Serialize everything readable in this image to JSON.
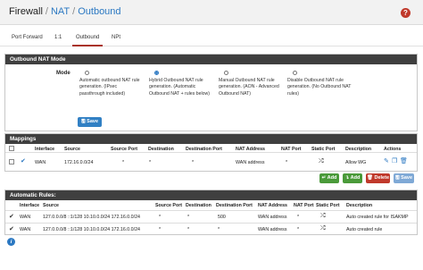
{
  "breadcrumb": {
    "part1": "Firewall",
    "sep1": "/",
    "part2": "NAT",
    "sep2": "/",
    "part3": "Outbound"
  },
  "help_icon": "?",
  "tabs": [
    {
      "label": "Port Forward",
      "active": false
    },
    {
      "label": "1:1",
      "active": false
    },
    {
      "label": "Outbound",
      "active": true
    },
    {
      "label": "NPt",
      "active": false
    }
  ],
  "mode_panel": {
    "title": "Outbound NAT Mode",
    "mode_label": "Mode",
    "options": [
      {
        "text": "Automatic outbound NAT rule generation. (IPsec passthrough included)",
        "checked": false
      },
      {
        "text": "Hybrid Outbound NAT rule generation. (Automatic Outbound NAT + rules below)",
        "checked": true
      },
      {
        "text": "Manual Outbound NAT rule generation. (AON - Advanced Outbound NAT)",
        "checked": false
      },
      {
        "text": "Disable Outbound NAT rule generation. (No Outbound NAT rules)",
        "checked": false
      }
    ],
    "save_label": "Save"
  },
  "mappings": {
    "title": "Mappings",
    "headers": [
      "Interface",
      "Source",
      "Source Port",
      "Destination",
      "Destination Port",
      "NAT Address",
      "NAT Port",
      "Static Port",
      "Description",
      "Actions"
    ],
    "rows": [
      {
        "interface": "WAN",
        "source": "172.16.0.0/24",
        "source_port": "*",
        "destination": "*",
        "destination_port": "*",
        "nat_address": "WAN address",
        "nat_port": "*",
        "static_port": "⚔",
        "description": "Allow WG"
      }
    ],
    "buttons": {
      "add_top": "Add",
      "add_bottom": "Add",
      "delete": "Delete",
      "save": "Save"
    }
  },
  "auto_rules": {
    "title": "Automatic Rules:",
    "headers": [
      "Interface",
      "Source",
      "Source Port",
      "Destination",
      "Destination Port",
      "NAT Address",
      "NAT Port",
      "Static Port",
      "Description"
    ],
    "rows": [
      {
        "interface": "WAN",
        "source": "127.0.0.0/8 ::1/128 10.10.0.0/24 172.16.0.0/24",
        "source_port": "*",
        "destination": "*",
        "destination_port": "500",
        "nat_address": "WAN address",
        "nat_port": "*",
        "description": "Auto created rule for ISAKMP"
      },
      {
        "interface": "WAN",
        "source": "127.0.0.0/8 ::1/128 10.10.0.0/24 172.16.0.0/24",
        "source_port": "*",
        "destination": "*",
        "destination_port": "*",
        "nat_address": "WAN address",
        "nat_port": "*",
        "description": "Auto created rule"
      }
    ]
  },
  "info_icon": "i",
  "colors": {
    "accent_blue": "#2b78c2",
    "header_dark": "#3f3f3f",
    "active_tab": "#a93226",
    "add_green": "#4a9a3a",
    "delete_red": "#c0392b"
  }
}
